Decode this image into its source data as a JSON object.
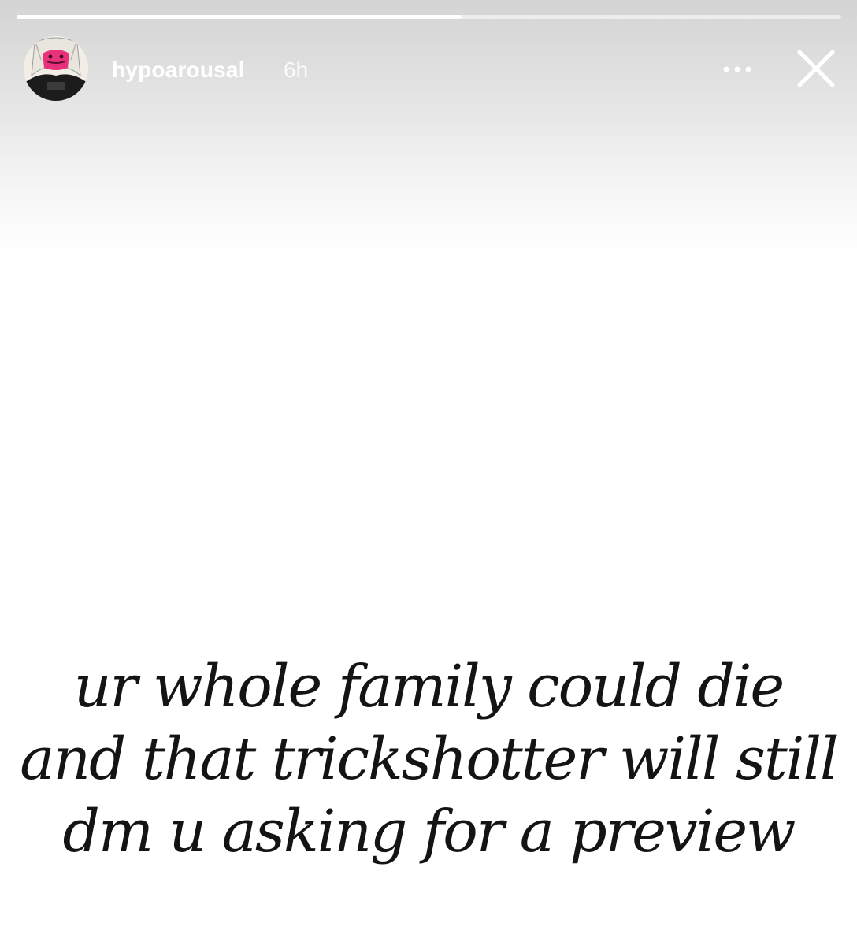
{
  "story": {
    "progress_fraction": 0.54,
    "user": {
      "username": "hypoarousal",
      "timestamp": "6h",
      "avatar_icon": "profile-avatar-icon"
    },
    "actions": {
      "more_icon": "more-options-icon",
      "close_icon": "close-icon"
    },
    "caption": {
      "lines": [
        "ur whole family could die",
        "and that trickshotter will still",
        "dm u asking for a preview"
      ]
    }
  },
  "colors": {
    "background": "#ffffff",
    "header_gradient": "#d4d4d4",
    "header_text": "#ffffff",
    "caption_text": "#141414",
    "avatar_accent": "#e8317a"
  }
}
